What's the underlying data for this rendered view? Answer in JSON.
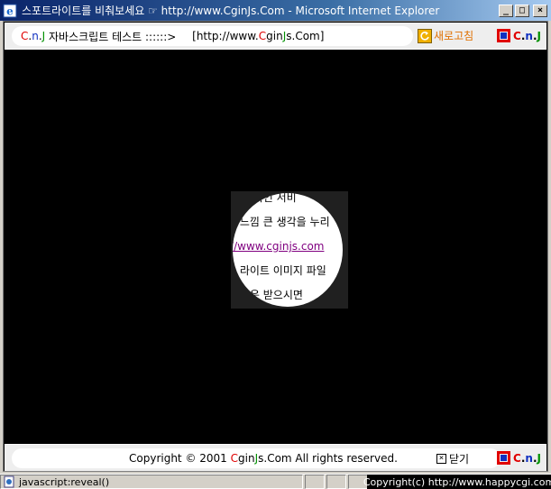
{
  "window": {
    "title": "스포트라이트를 비춰보세요 ☞ http://www.CginJs.Com - Microsoft Internet Explorer",
    "minimize_glyph": "_",
    "maximize_glyph": "□",
    "close_glyph": "×"
  },
  "banner": {
    "logo_c": "C",
    "logo_dot1": ".",
    "logo_n": "n",
    "logo_dot2": ".",
    "logo_j": "J",
    "title": " 자바스크립트 테스트 ::::::> ",
    "url_prefix": "[http://www. ",
    "url_c": "C",
    "url_gin": "gin",
    "url_j": "J",
    "url_suffix": "s.Com]",
    "refresh_label": "새로고침",
    "brand_c": "C",
    "brand_dot1": ".",
    "brand_n": "n",
    "brand_dot2": ".",
    "brand_j": "J"
  },
  "spotlight": {
    "lines": [
      "는 알 목인 서비",
      "도 느낌 큰 생각을 누리",
      "://www.cginjs.com",
      "트 라이트 이미지 파일",
      "는 다운 받으시면"
    ]
  },
  "footer": {
    "copyright_prefix": "Copyright © 2001 ",
    "copyright_c": "C",
    "copyright_gin": "gin",
    "copyright_j": "J",
    "copyright_suffix": "s.Com All rights reserved.",
    "close_glyph": "×",
    "close_label": "닫기",
    "brand_c": "C",
    "brand_dot1": ".",
    "brand_n": "n",
    "brand_dot2": ".",
    "brand_j": "J"
  },
  "statusbar": {
    "text": "javascript:reveal()",
    "right_text": "Copyright(c) http://www.happycgi.com"
  },
  "colors": {
    "title_gradient_start": "#0a246a",
    "logo_red": "#e00000",
    "logo_blue": "#1030c0",
    "logo_green": "#009000",
    "refresh_orange": "#e07000",
    "link_purple": "#800080"
  },
  "icons": {
    "title": "internet-explorer-icon",
    "refresh": "refresh-icon",
    "brand": "cnj-logo-icon",
    "close": "close-box-icon",
    "status": "page-icon"
  }
}
